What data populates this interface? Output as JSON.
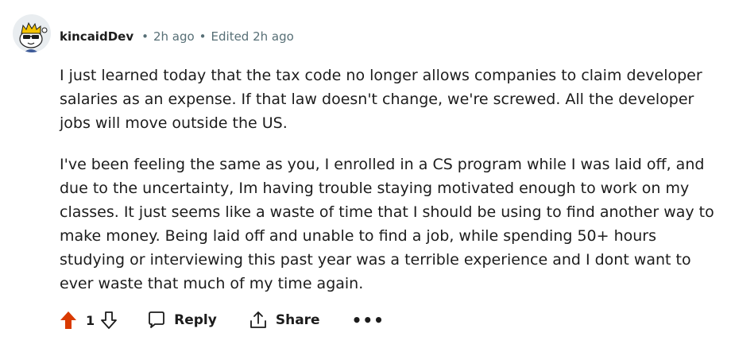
{
  "comment": {
    "author": "kincaidDev",
    "time_ago": "2h ago",
    "edited": "Edited 2h ago",
    "paragraphs": [
      "I just learned today that the tax code no longer allows companies to claim developer salaries as an expense. If that law doesn't change, we're screwed. All the developer jobs will move outside the US.",
      "I've been feeling the same as you, I enrolled in a CS program while I was laid off, and due to the uncertainty, Im having trouble staying motivated enough to work on my classes. It just seems like a waste of time that I should be using to find another way to make money. Being laid off and unable to find a job, while spending 50+ hours studying or interviewing this past year was a terrible experience and I dont want to ever waste that much of my time again."
    ]
  },
  "actions": {
    "score": "1",
    "reply_label": "Reply",
    "share_label": "Share",
    "more_label": "•••"
  },
  "colors": {
    "upvote_active": "#d93a00",
    "meta_text": "#576f76",
    "body_text": "#1c1c1c"
  },
  "icons": {
    "avatar": "snoo-avatar-icon",
    "upvote": "upvote-arrow-icon",
    "downvote": "downvote-arrow-icon",
    "reply": "comment-bubble-icon",
    "share": "share-icon"
  }
}
